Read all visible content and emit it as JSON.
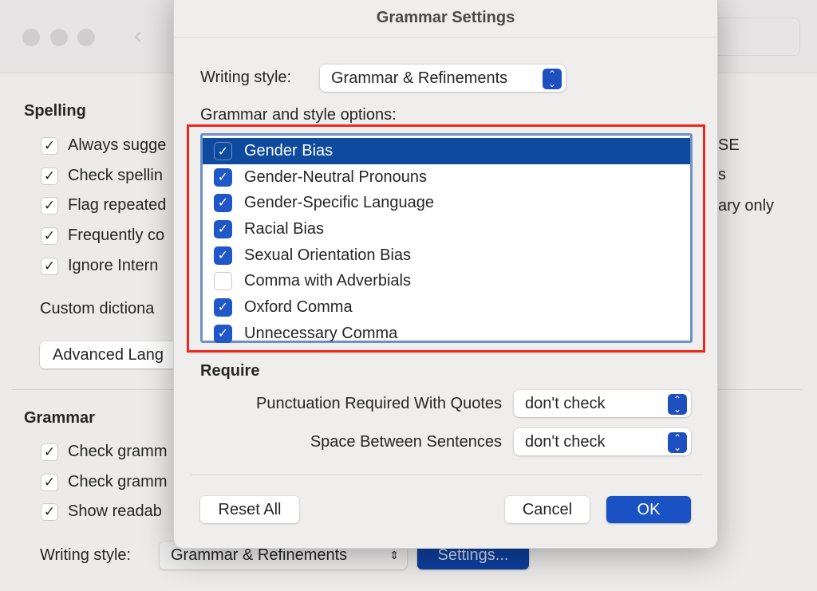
{
  "background": {
    "spelling_header": "Spelling",
    "spelling_items": [
      {
        "label": "Always sugge",
        "checked": true
      },
      {
        "label": "Check spellin",
        "checked": true
      },
      {
        "label": "Flag repeated",
        "checked": true
      },
      {
        "label": "Frequently co",
        "checked": true
      },
      {
        "label": "Ignore Intern",
        "checked": true
      }
    ],
    "right_fragments": [
      "SE",
      "s",
      "ary only"
    ],
    "custom_dictionaries": "Custom dictiona",
    "advanced_button": "Advanced Lang",
    "grammar_header": "Grammar",
    "grammar_items": [
      {
        "label": "Check gramm",
        "checked": true
      },
      {
        "label": "Check gramm",
        "checked": true
      },
      {
        "label": "Show readab",
        "checked": true
      }
    ],
    "writing_style_label": "Writing style:",
    "writing_style_value": "Grammar & Refinements",
    "settings_button": "Settings..."
  },
  "dialog": {
    "title": "Grammar Settings",
    "writing_style_label": "Writing style:",
    "writing_style_value": "Grammar & Refinements",
    "options_label": "Grammar and style options:",
    "options": [
      {
        "label": "Gender Bias",
        "checked": true,
        "selected": true
      },
      {
        "label": "Gender-Neutral Pronouns",
        "checked": true
      },
      {
        "label": "Gender-Specific Language",
        "checked": true
      },
      {
        "label": "Racial Bias",
        "checked": true
      },
      {
        "label": "Sexual Orientation Bias",
        "checked": true
      },
      {
        "label": "Comma with Adverbials",
        "checked": false
      },
      {
        "label": "Oxford Comma",
        "checked": true
      },
      {
        "label": "Unnecessary Comma",
        "checked": true
      }
    ],
    "require_header": "Require",
    "punctuation_label": "Punctuation Required With Quotes",
    "punctuation_value": "don't check",
    "space_label": "Space Between Sentences",
    "space_value": "don't check",
    "reset_button": "Reset All",
    "cancel_button": "Cancel",
    "ok_button": "OK"
  },
  "colors": {
    "accent": "#1f57c9",
    "highlight_box": "#f0261b",
    "selected_row": "#0e4a9e"
  }
}
